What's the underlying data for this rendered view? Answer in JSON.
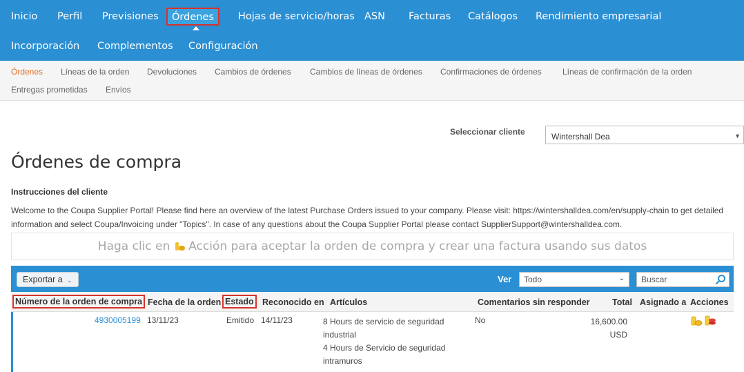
{
  "topnav": {
    "row1": [
      "Inicio",
      "Perfil",
      "Previsiones",
      "Órdenes",
      "Hojas de servicio/horas",
      "ASN",
      "Facturas",
      "Catálogos",
      "Rendimiento empresarial"
    ],
    "row2": [
      "Incorporación",
      "Complementos",
      "Configuración"
    ],
    "active": "Órdenes"
  },
  "subnav": {
    "items": [
      "Órdenes",
      "Líneas de la orden",
      "Devoluciones",
      "Cambios de órdenes",
      "Cambios de líneas de órdenes",
      "Confirmaciones de órdenes",
      "Líneas de confirmación de la orden",
      "Entregas prometidas",
      "Envíos"
    ],
    "active": "Órdenes"
  },
  "client": {
    "label": "Seleccionar cliente",
    "value": "Wintershall Dea"
  },
  "page": {
    "title": "Órdenes de compra"
  },
  "instructions": {
    "title": "Instrucciones del cliente",
    "text": "Welcome to the Coupa Supplier Portal! Please find here an overview of the latest Purchase Orders issued to your company. Please visit: https://wintershalldea.com/en/supply-chain to get detailed information and select Coupa/Invoicing under \"Topics\". In case of any questions about the Coupa Supplier Portal please contact SupplierSupport@wintershalldea.com."
  },
  "banner": {
    "before": "Haga clic en",
    "after": "Acción para aceptar la orden de compra y crear una factura usando sus datos"
  },
  "toolbar": {
    "export_label": "Exportar a",
    "ver_label": "Ver",
    "ver_value": "Todo",
    "search_placeholder": "Buscar"
  },
  "table": {
    "headers": [
      "Número de la orden de compra",
      "Fecha de la orden",
      "Estado",
      "Reconocido en",
      "Artículos",
      "Comentarios sin responder",
      "Total",
      "Asignado a",
      "Acciones"
    ],
    "rows": [
      {
        "po_number": "4930005199",
        "order_date": "13/11/23",
        "status": "Emitido",
        "acknowledged": "14/11/23",
        "items": [
          "8 Hours de servicio de seguridad industrial",
          "4 Hours de Servicio de seguridad intramuros"
        ],
        "comments": "No",
        "total_amount": "16,600.00",
        "total_currency": "USD",
        "assigned": ""
      }
    ]
  },
  "colors": {
    "brand_blue": "#2b8fd3",
    "active_orange": "#e0702a",
    "highlight_red": "#d8322c"
  }
}
